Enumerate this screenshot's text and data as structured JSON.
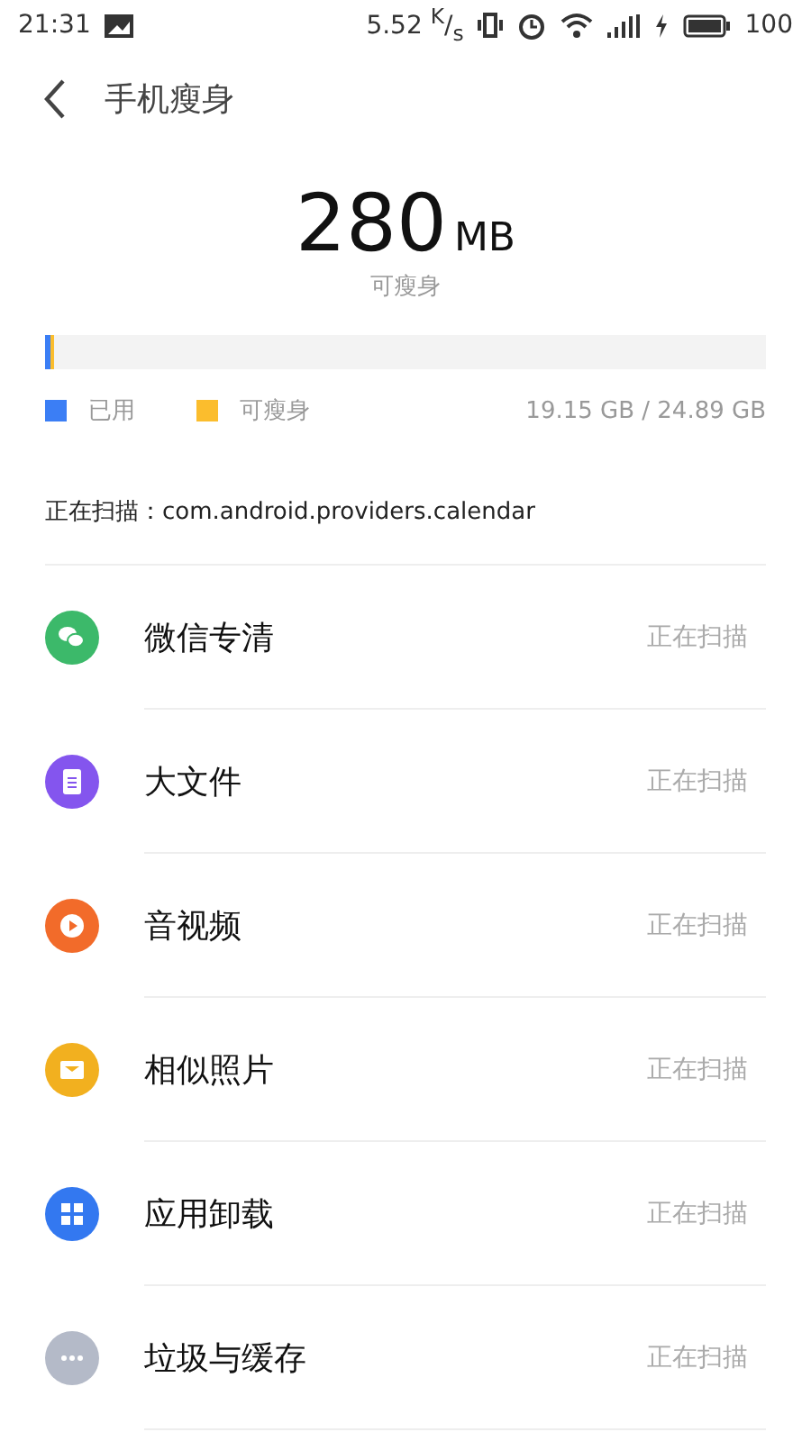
{
  "status_bar": {
    "time": "21:31",
    "speed": "5.52 $^{K}$/$_{s}$",
    "battery": "100"
  },
  "header": {
    "title": "手机瘦身"
  },
  "summary": {
    "amount": "280",
    "unit": "MB",
    "caption": "可瘦身"
  },
  "storage": {
    "segments": [
      {
        "name": "已用",
        "color": "#3b7ef5",
        "level": 0.008
      },
      {
        "name": "可瘦身",
        "color": "#fbbd2d",
        "level": 0.003
      }
    ],
    "usage": "19.15 GB / 24.89 GB"
  },
  "scanning": "正在扫描：com.android.providers.calendar",
  "categories": [
    {
      "kind": "wechat",
      "color": "#3cb96a",
      "title": "微信专清",
      "status": "正在扫描"
    },
    {
      "kind": "file",
      "color": "#8455ee",
      "title": "大文件",
      "status": "正在扫描"
    },
    {
      "kind": "video",
      "color": "#f26b2a",
      "title": "音视频",
      "status": "正在扫描"
    },
    {
      "kind": "photo",
      "color": "#f2b01f",
      "title": "相似照片",
      "status": "正在扫描"
    },
    {
      "kind": "apps",
      "color": "#3378f0",
      "title": "应用卸载",
      "status": "正在扫描"
    },
    {
      "kind": "more",
      "color": "#b4bac8",
      "title": "垃圾与缓存",
      "status": "正在扫描"
    }
  ]
}
